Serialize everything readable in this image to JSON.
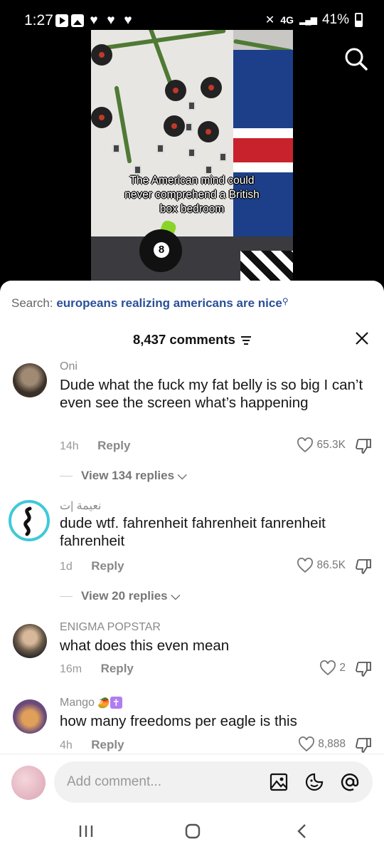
{
  "status_bar": {
    "time": "1:27",
    "network": "4G",
    "battery": "41%"
  },
  "video": {
    "caption_line1": "The American mind could",
    "caption_line2": "never comprehend a British",
    "caption_line3": "box bedroom",
    "ball_number": "8"
  },
  "sheet": {
    "search_label": "Search:",
    "search_query": "europeans realizing americans are nice",
    "comment_count": "8,437 comments",
    "input_placeholder": "Add comment..."
  },
  "comments": [
    {
      "username": "Oni",
      "text": "Dude what the fuck my fat belly is so big I can’t even see the screen what’s happening",
      "time": "14h",
      "reply_label": "Reply",
      "likes": "65.3K",
      "view_replies": "View 134 replies"
    },
    {
      "username": "نعيمة |ت",
      "text": "dude wtf. fahrenheit fahrenheit fanrenheit fahrenheit",
      "time": "1d",
      "reply_label": "Reply",
      "likes": "86.5K",
      "view_replies": "View 20 replies"
    },
    {
      "username": "ENIGMA POPSTAR",
      "text": "what does this even mean",
      "time": "16m",
      "reply_label": "Reply",
      "likes": "2"
    },
    {
      "username": "Mango",
      "text": "how many freedoms per eagle is this",
      "time": "4h",
      "reply_label": "Reply",
      "likes": "8,888"
    }
  ],
  "colors": {
    "search_query": "#2a4f9a",
    "avatar_ring": "#3fc9d8"
  }
}
